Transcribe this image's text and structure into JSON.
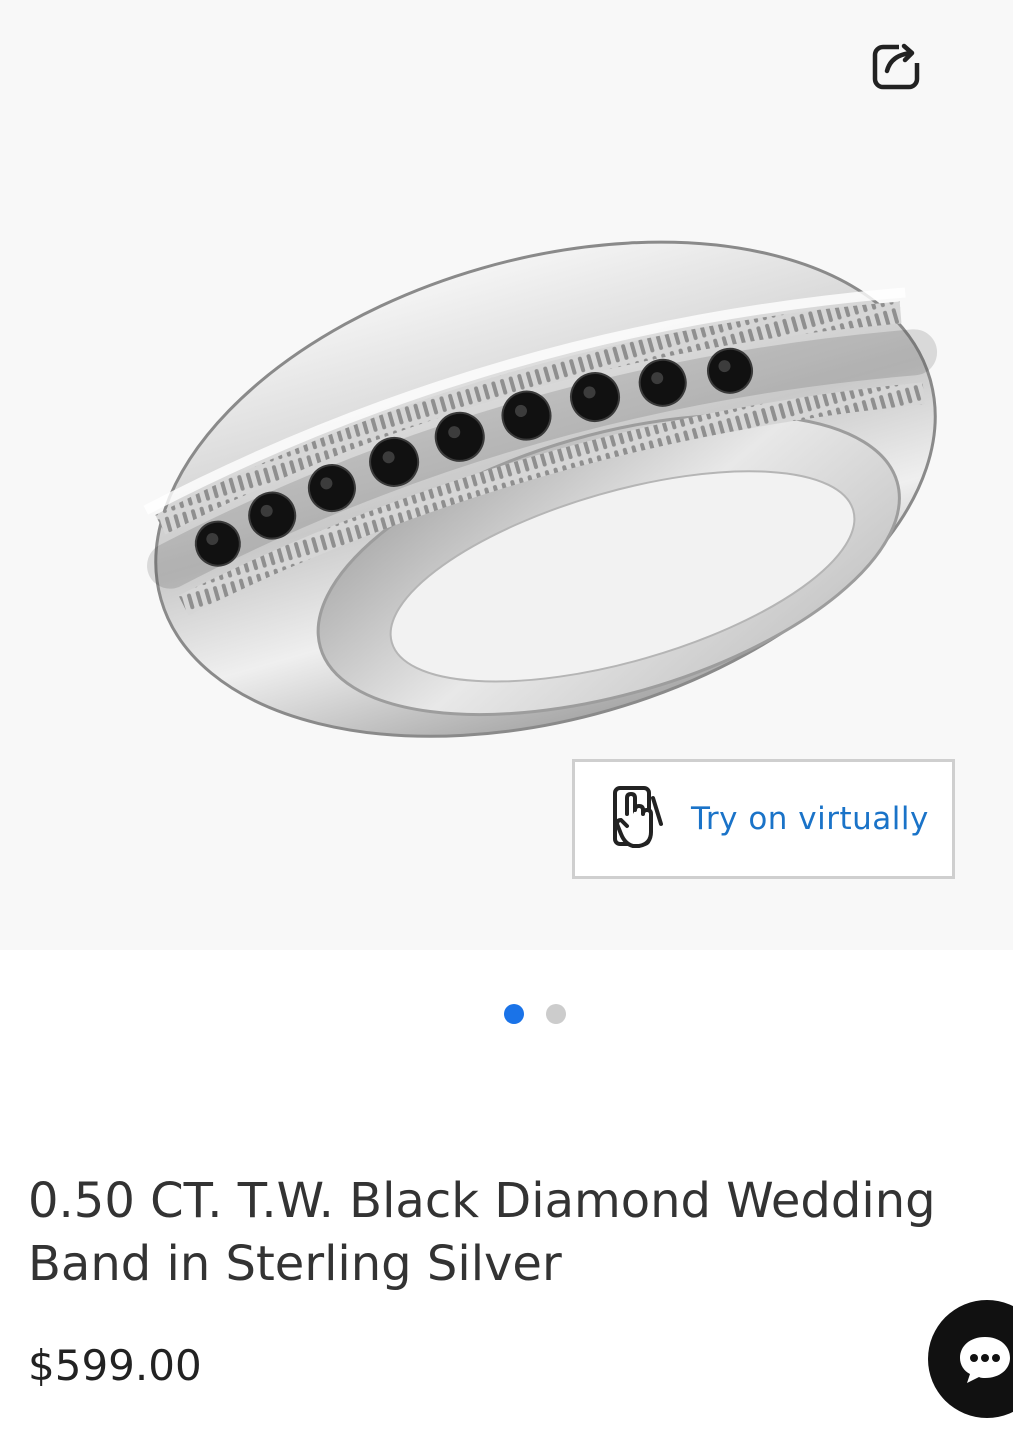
{
  "gallery": {
    "image_alt": "0.50 CT. T.W. Black Diamond Wedding Band in Sterling Silver",
    "try_on_label": "Try on virtually",
    "slides_total": 2,
    "slide_active": 1,
    "icons": {
      "share": "share-icon",
      "try_on": "phone-touch-icon"
    }
  },
  "product": {
    "title": "0.50 CT. T.W. Black Diamond Wedding Band in Sterling Silver",
    "price": "$599.00"
  },
  "chat": {
    "icon": "chat-bubble-icon"
  },
  "colors": {
    "accent_blue": "#1a73e8",
    "link_blue": "#1a73c8",
    "dot_inactive": "#cccccc",
    "chat_bg": "#111111"
  }
}
